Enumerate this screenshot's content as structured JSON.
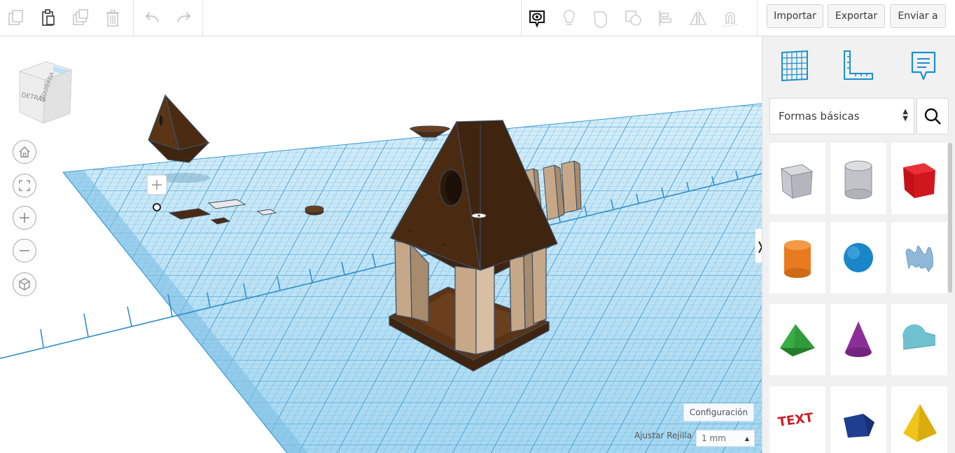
{
  "toolbar": {
    "left_tools": [
      "copy-icon",
      "paste-icon",
      "duplicate-icon",
      "trash-icon",
      "undo-icon",
      "redo-icon"
    ],
    "view_tools": [
      "notes-icon",
      "lightbulb-icon",
      "group-icon",
      "ungroup-icon",
      "align-icon",
      "mirror-icon",
      "magnet-icon"
    ],
    "import_label": "Importar",
    "export_label": "Exportar",
    "send_label": "Enviar a"
  },
  "view_cube": {
    "face_front": "DETRÁS",
    "face_side": "IZQUIERDA"
  },
  "nav_buttons": [
    "home-icon",
    "fit-icon",
    "zoom-in-icon",
    "zoom-out-icon",
    "perspective-icon"
  ],
  "panel": {
    "tools": [
      "workplane-icon",
      "ruler-icon",
      "notes-panel-icon"
    ],
    "category_label": "Formas básicas",
    "search_icon": "search-icon",
    "shapes": [
      {
        "name": "box-hole",
        "color": "#b9bcc2"
      },
      {
        "name": "cylinder-hole",
        "color": "#c1c3c8"
      },
      {
        "name": "box",
        "color": "#d1171d"
      },
      {
        "name": "cylinder",
        "color": "#e87a1f"
      },
      {
        "name": "sphere",
        "color": "#1a86c9"
      },
      {
        "name": "scribble",
        "color": "#8fb8d9"
      },
      {
        "name": "roof",
        "color": "#2f9b3a"
      },
      {
        "name": "cone",
        "color": "#8a2f98"
      },
      {
        "name": "round-roof",
        "color": "#6fc1cf"
      },
      {
        "name": "text",
        "color": "#cc1e25"
      },
      {
        "name": "polygon",
        "color": "#1f3d91"
      },
      {
        "name": "pyramid",
        "color": "#f0c419"
      }
    ],
    "collapse_glyph": "❭"
  },
  "settings": {
    "config_label": "Configuración",
    "grid_label": "Ajustar Rejilla",
    "grid_value": "1 mm"
  },
  "colors": {
    "workplane": "#7ec5e8",
    "grid_line": "#2f9bd6",
    "model_brown": "#4b2a12",
    "model_wood": "#c6a888"
  }
}
